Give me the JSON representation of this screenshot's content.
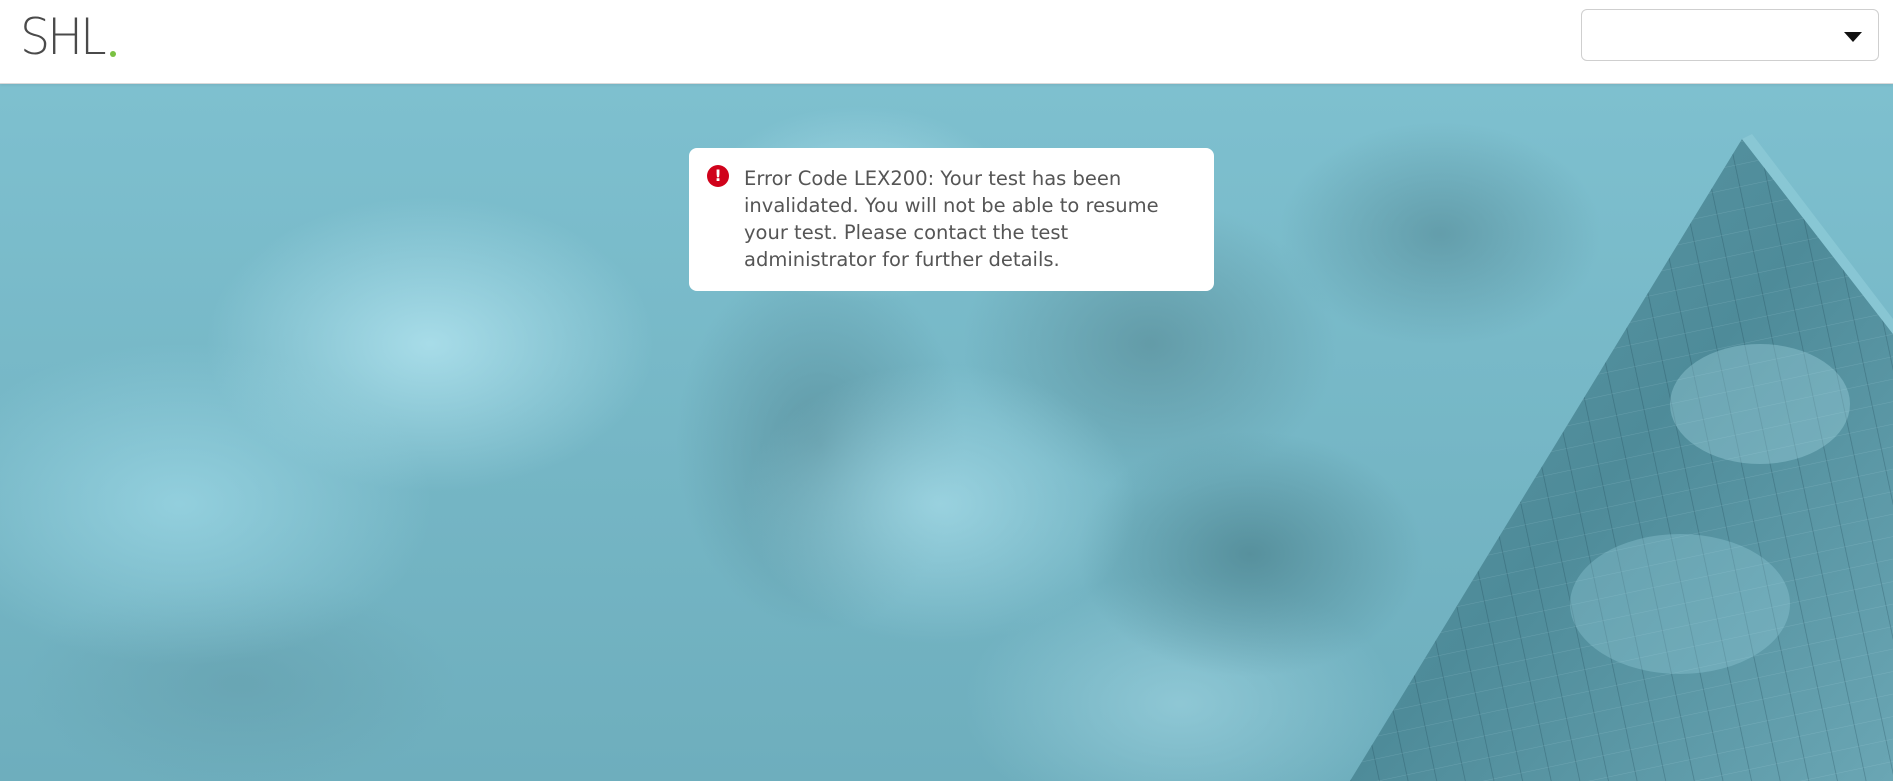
{
  "header": {
    "logo_text": "SHL",
    "logo_dot_color": "#7ac142",
    "language_select": {
      "value": "",
      "icon": "chevron-down-icon"
    }
  },
  "alert": {
    "icon": "error-exclamation-icon",
    "icon_color": "#d0021b",
    "message": "Error Code LEX200: Your test has been invalidated. You will not be able to resume your test. Please contact the test administrator for further details."
  },
  "background": {
    "description_color": "#7fc1d0"
  }
}
